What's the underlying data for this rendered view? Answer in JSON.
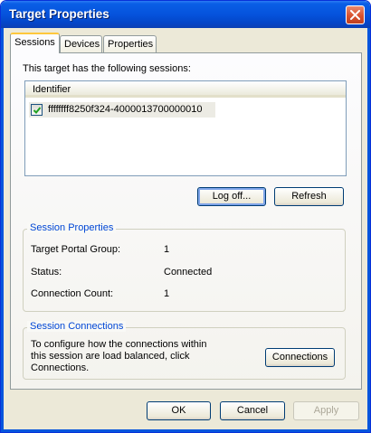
{
  "window": {
    "title": "Target Properties",
    "close_icon": "close-icon"
  },
  "tabs": [
    {
      "label": "Sessions",
      "active": true
    },
    {
      "label": "Devices",
      "active": false
    },
    {
      "label": "Properties",
      "active": false
    }
  ],
  "sessions": {
    "intro": "This target has the following sessions:",
    "column_header": "Identifier",
    "rows": [
      {
        "identifier": "ffffffff8250f324-4000013700000010",
        "checked": true
      }
    ],
    "logoff_label": "Log off...",
    "refresh_label": "Refresh"
  },
  "session_properties": {
    "title": "Session Properties",
    "fields": [
      {
        "label": "Target Portal Group:",
        "value": "1"
      },
      {
        "label": "Status:",
        "value": "Connected"
      },
      {
        "label": "Connection Count:",
        "value": "1"
      }
    ]
  },
  "session_connections": {
    "title": "Session Connections",
    "description_lines": [
      "To configure how the connections within",
      "this session are load balanced, click",
      "Connections."
    ],
    "button_label": "Connections"
  },
  "footer": {
    "ok_label": "OK",
    "cancel_label": "Cancel",
    "apply_label": "Apply"
  },
  "colors": {
    "titlebar": "#0553dc",
    "dialog_bg": "#ece9d8",
    "group_title": "#0046d5"
  }
}
